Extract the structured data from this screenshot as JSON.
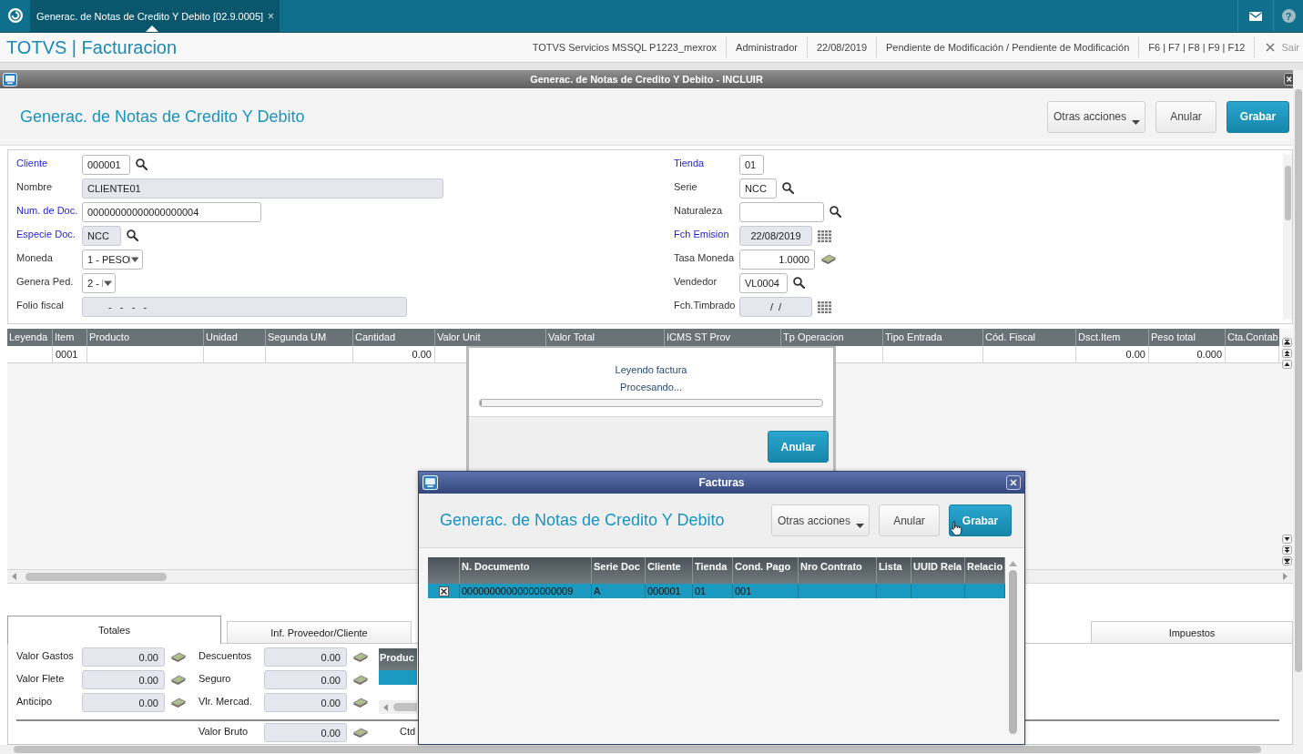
{
  "app_bar": {
    "tab": {
      "title": "Generac. de Notas de Credito Y Debito [02.9.0005]",
      "close": "×"
    },
    "help": "?"
  },
  "header": {
    "title": "TOTVS | Facturacion",
    "info": [
      "TOTVS Servicios MSSQL P1223_mexrox",
      "Administrador",
      "22/08/2019",
      "Pendiente de Modificación / Pendiente de Modificación",
      "F6 | F7 | F8 | F9 | F12"
    ],
    "exit": "Sair"
  },
  "window": {
    "title": "Generac. de Notas de Credito Y Debito - INCLUIR",
    "heading": "Generac. de Notas de Credito Y Debito",
    "buttons": [
      {
        "label": "Otras acciones",
        "kind": "menu"
      },
      {
        "label": "Anular",
        "kind": "secondary"
      },
      {
        "label": "Grabar",
        "kind": "primary"
      }
    ]
  },
  "form": {
    "left": [
      {
        "label": "Cliente",
        "required": true,
        "kind": "lookup",
        "value": "000001",
        "disabled": false
      },
      {
        "label": "Nombre",
        "required": false,
        "kind": "text",
        "value": "CLIENTE01",
        "disabled": true
      },
      {
        "label": "Num. de Doc.",
        "required": true,
        "kind": "text",
        "value": "00000000000000000004",
        "disabled": false
      },
      {
        "label": "Especie Doc.",
        "required": true,
        "kind": "lookup",
        "value": "NCC",
        "disabled": true
      },
      {
        "label": "Moneda",
        "required": false,
        "kind": "select",
        "value": "1 - PESO",
        "disabled": false
      },
      {
        "label": "Genera Ped.",
        "required": false,
        "kind": "select",
        "value": "2 -",
        "disabled": false
      },
      {
        "label": "Folio fiscal",
        "required": false,
        "kind": "mask",
        "value": "-   -   -   -",
        "disabled": true
      }
    ],
    "right": [
      {
        "label": "Tienda",
        "required": true,
        "kind": "text",
        "value": "01",
        "disabled": false
      },
      {
        "label": "Serie",
        "required": false,
        "kind": "lookup",
        "value": "NCC",
        "disabled": false
      },
      {
        "label": "Naturaleza",
        "required": false,
        "kind": "lookup",
        "disabled": false
      },
      {
        "label": "Fch Emision",
        "required": true,
        "kind": "date",
        "value": "22/08/2019",
        "disabled": true
      },
      {
        "label": "Tasa Moneda",
        "required": false,
        "kind": "amount",
        "value": "1.0000",
        "disabled": false
      },
      {
        "label": "Vendedor",
        "required": false,
        "kind": "lookup",
        "value": "VL0004",
        "disabled": false
      },
      {
        "label": "Fch.Timbrado",
        "required": false,
        "kind": "date",
        "value": "/  /",
        "disabled": true
      }
    ]
  },
  "items_grid": {
    "columns": [
      {
        "header": "Leyenda"
      },
      {
        "header": "Item",
        "kind": "text",
        "value": "0001"
      },
      {
        "header": "Producto"
      },
      {
        "header": "Unidad"
      },
      {
        "header": "Segunda UM"
      },
      {
        "header": "Cantidad",
        "kind": "number",
        "value": "0.00"
      },
      {
        "header": "Valor Unit"
      },
      {
        "header": "Valor Total"
      },
      {
        "header": "ICMS ST Prov"
      },
      {
        "header": "Tp Operacion"
      },
      {
        "header": "Tipo Entrada"
      },
      {
        "header": "Cód. Fiscal"
      },
      {
        "header": "Dsct.Item",
        "kind": "number",
        "value": "0.00"
      },
      {
        "header": "Peso total",
        "kind": "number",
        "value": "0.000"
      },
      {
        "header": "Cta.Contab"
      }
    ]
  },
  "processing": {
    "message": "Leyendo factura",
    "status": "Procesando...",
    "progress": {
      "level": 0
    },
    "button": "Anular"
  },
  "folder_tabs": [
    {
      "label": "Totales",
      "selected": true
    },
    {
      "label": "Inf. Proveedor/Cliente",
      "selected": false
    },
    {
      "label": "Impuestos",
      "selected": false
    }
  ],
  "totals": {
    "fields": [
      {
        "label": "Valor Gastos",
        "value": "0.00"
      },
      {
        "label": "Descuentos",
        "value": "0.00"
      },
      {
        "label": "Valor Flete",
        "value": "0.00"
      },
      {
        "label": "Seguro",
        "value": "0.00"
      },
      {
        "label": "Anticipo",
        "value": "0.00"
      },
      {
        "label": "Vlr. Mercad.",
        "value": "0.00"
      }
    ],
    "products_grid": {
      "columns": [
        "Produc"
      ],
      "rows": [
        {
          "selected": true
        }
      ]
    },
    "gross": {
      "label": "Valor Bruto",
      "value": "0.00"
    },
    "side_label": "Ctd"
  },
  "invoices_dialog": {
    "title": "Facturas",
    "heading": "Generac. de Notas de Credito Y Debito",
    "buttons": [
      {
        "label": "Otras acciones",
        "kind": "menu"
      },
      {
        "label": "Anular",
        "kind": "secondary"
      },
      {
        "label": "Grabar",
        "kind": "primary"
      }
    ],
    "grid": {
      "columns": [
        "N. Documento",
        "Serie Doc",
        "Cliente",
        "Tienda",
        "Cond. Pago",
        "Nro Contrato",
        "Lista",
        "UUID Rela",
        "Relacio"
      ],
      "rows": [
        {
          "selected": true,
          "checked": true,
          "cells": [
            "00000000000000000009",
            "A",
            "000001",
            "01",
            "001"
          ]
        }
      ]
    }
  }
}
